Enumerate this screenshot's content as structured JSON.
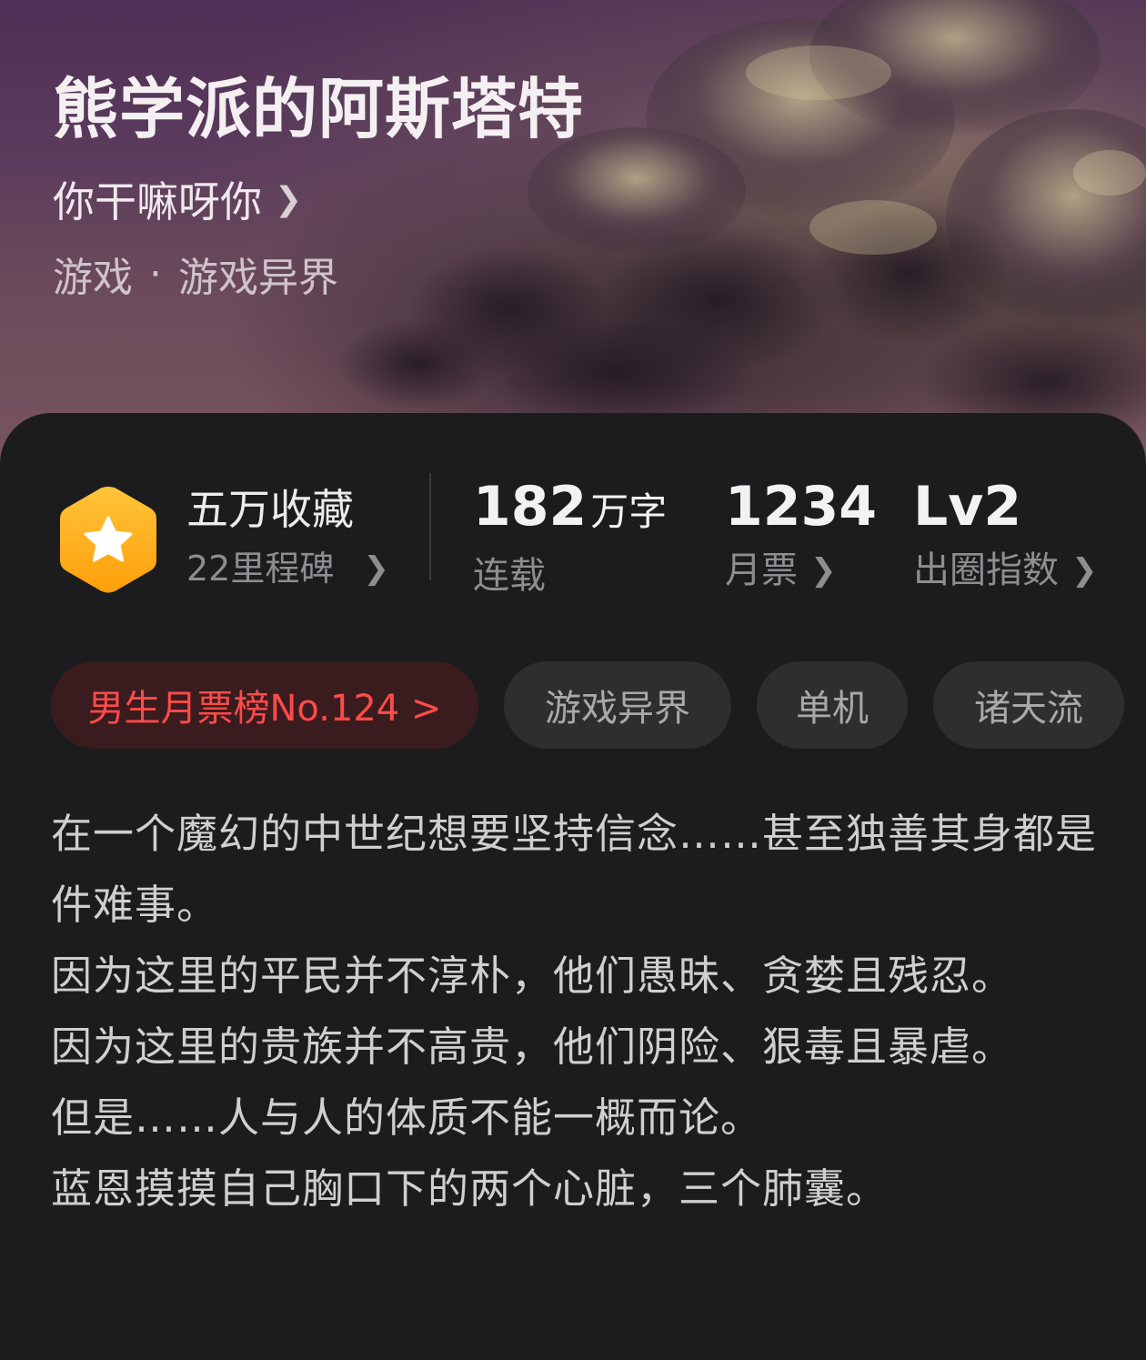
{
  "book": {
    "title": "熊学派的阿斯塔特",
    "author": "你干嘛呀你",
    "genre_main": "游戏",
    "genre_sub": "游戏异界"
  },
  "colors": {
    "background": "#1c1c1e",
    "rank_tag_text": "#ff4a4a",
    "badge_gold": "#ffb21c"
  },
  "stats": {
    "collection_title": "五万收藏",
    "milestones": "22里程碑",
    "word_count_value": "182",
    "word_count_unit": "万字",
    "status": "连载",
    "monthly_votes_value": "1234",
    "monthly_votes_label": "月票",
    "popularity_value": "Lv2",
    "popularity_label": "出圈指数"
  },
  "tags": [
    {
      "label": "男生月票榜No.124 >"
    },
    {
      "label": "游戏异界"
    },
    {
      "label": "单机"
    },
    {
      "label": "诸天流"
    }
  ],
  "description": [
    "在一个魔幻的中世纪想要坚持信念……甚至独善其身都是件难事。",
    "因为这里的平民并不淳朴，他们愚昧、贪婪且残忍。",
    "因为这里的贵族并不高贵，他们阴险、狠毒且暴虐。",
    "但是……人与人的体质不能一概而论。",
    "蓝恩摸摸自己胸口下的两个心脏，三个肺囊。"
  ],
  "icons": {
    "author_chevron": "chevron-right-icon",
    "badge": "star-hexagon-icon"
  }
}
